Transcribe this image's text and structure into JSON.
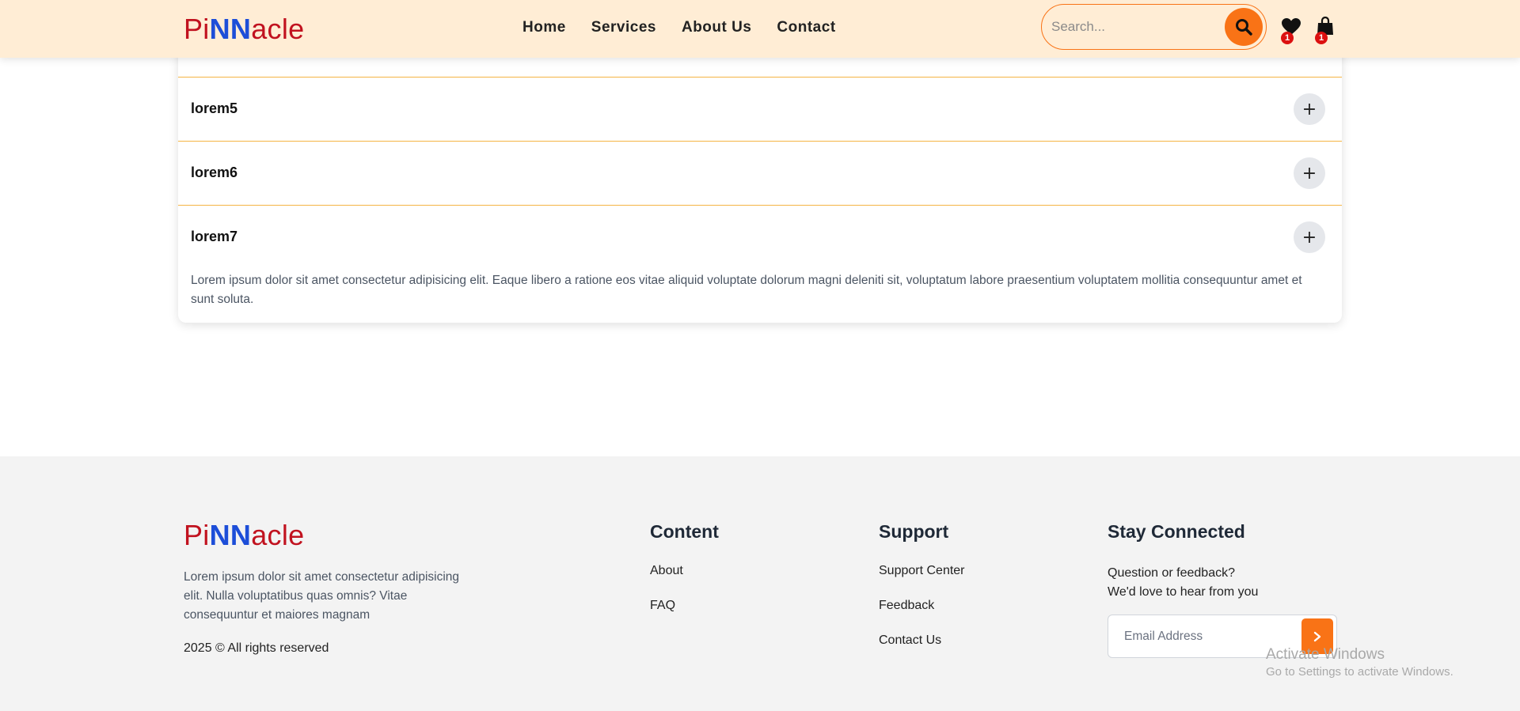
{
  "header": {
    "logo": {
      "part1": "Pi",
      "part2": "NN",
      "part3": "acle"
    },
    "nav": [
      "Home",
      "Services",
      "About Us",
      "Contact"
    ],
    "search_placeholder": "Search...",
    "wishlist_count": "1",
    "cart_count": "1"
  },
  "faq": {
    "items": [
      {
        "question": "lorem5",
        "expanded": false
      },
      {
        "question": "lorem6",
        "expanded": false
      },
      {
        "question": "lorem7",
        "expanded": true,
        "answer": "Lorem ipsum dolor sit amet consectetur adipisicing elit. Eaque libero a ratione eos vitae aliquid voluptate dolorum magni deleniti sit, voluptatum labore praesentium voluptatem mollitia consequuntur amet et sunt soluta."
      }
    ],
    "toggle_symbol": "+"
  },
  "footer": {
    "logo": {
      "part1": "Pi",
      "part2": "NN",
      "part3": "acle"
    },
    "description": "Lorem ipsum dolor sit amet consectetur adipisicing elit. Nulla voluptatibus quas omnis? Vitae consequuntur et maiores magnam",
    "copyright": "2025 © All rights reserved",
    "content": {
      "title": "Content",
      "links": [
        "About",
        "FAQ"
      ]
    },
    "support": {
      "title": "Support",
      "links": [
        "Support Center",
        "Feedback",
        "Contact Us"
      ]
    },
    "stay": {
      "title": "Stay Connected",
      "line1": "Question or feedback?",
      "line2": "We'd love to hear from you",
      "email_placeholder": "Email Address"
    }
  },
  "watermark": {
    "line1": "Activate Windows",
    "line2": "Go to Settings to activate Windows."
  },
  "colors": {
    "accent": "#f97316",
    "header_bg": "#ffedd5",
    "logo_red": "#c1121f",
    "logo_blue": "#1d4ed8",
    "divider": "#f5b444",
    "footer_bg": "#f3f3f3",
    "badge": "#dc1010"
  },
  "icons": [
    "search-icon",
    "heart-icon",
    "shopping-bag-icon",
    "plus-icon",
    "chevron-right-icon"
  ]
}
